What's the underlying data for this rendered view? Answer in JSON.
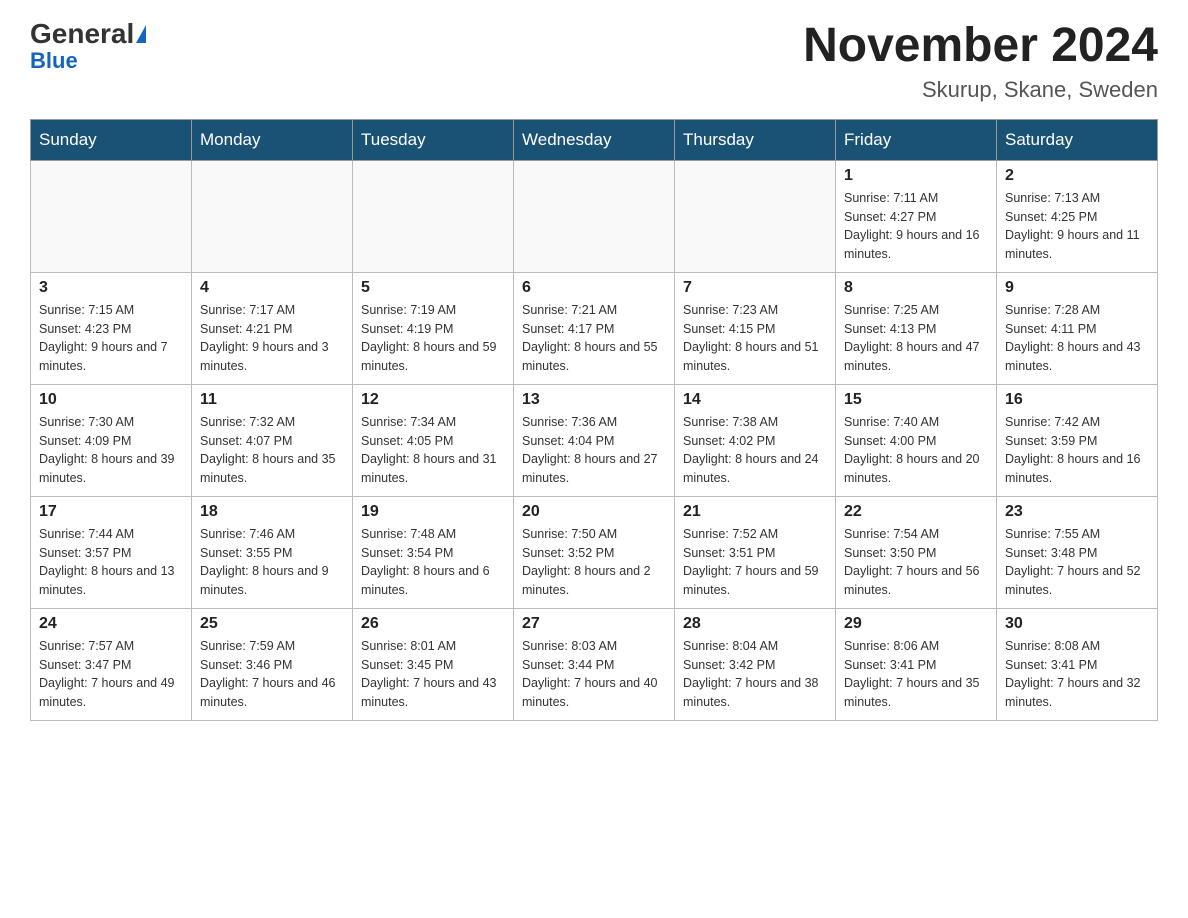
{
  "header": {
    "logo_general": "General",
    "logo_blue": "Blue",
    "title": "November 2024",
    "subtitle": "Skurup, Skane, Sweden"
  },
  "weekdays": [
    "Sunday",
    "Monday",
    "Tuesday",
    "Wednesday",
    "Thursday",
    "Friday",
    "Saturday"
  ],
  "weeks": [
    [
      {
        "day": "",
        "info": ""
      },
      {
        "day": "",
        "info": ""
      },
      {
        "day": "",
        "info": ""
      },
      {
        "day": "",
        "info": ""
      },
      {
        "day": "",
        "info": ""
      },
      {
        "day": "1",
        "info": "Sunrise: 7:11 AM\nSunset: 4:27 PM\nDaylight: 9 hours and 16 minutes."
      },
      {
        "day": "2",
        "info": "Sunrise: 7:13 AM\nSunset: 4:25 PM\nDaylight: 9 hours and 11 minutes."
      }
    ],
    [
      {
        "day": "3",
        "info": "Sunrise: 7:15 AM\nSunset: 4:23 PM\nDaylight: 9 hours and 7 minutes."
      },
      {
        "day": "4",
        "info": "Sunrise: 7:17 AM\nSunset: 4:21 PM\nDaylight: 9 hours and 3 minutes."
      },
      {
        "day": "5",
        "info": "Sunrise: 7:19 AM\nSunset: 4:19 PM\nDaylight: 8 hours and 59 minutes."
      },
      {
        "day": "6",
        "info": "Sunrise: 7:21 AM\nSunset: 4:17 PM\nDaylight: 8 hours and 55 minutes."
      },
      {
        "day": "7",
        "info": "Sunrise: 7:23 AM\nSunset: 4:15 PM\nDaylight: 8 hours and 51 minutes."
      },
      {
        "day": "8",
        "info": "Sunrise: 7:25 AM\nSunset: 4:13 PM\nDaylight: 8 hours and 47 minutes."
      },
      {
        "day": "9",
        "info": "Sunrise: 7:28 AM\nSunset: 4:11 PM\nDaylight: 8 hours and 43 minutes."
      }
    ],
    [
      {
        "day": "10",
        "info": "Sunrise: 7:30 AM\nSunset: 4:09 PM\nDaylight: 8 hours and 39 minutes."
      },
      {
        "day": "11",
        "info": "Sunrise: 7:32 AM\nSunset: 4:07 PM\nDaylight: 8 hours and 35 minutes."
      },
      {
        "day": "12",
        "info": "Sunrise: 7:34 AM\nSunset: 4:05 PM\nDaylight: 8 hours and 31 minutes."
      },
      {
        "day": "13",
        "info": "Sunrise: 7:36 AM\nSunset: 4:04 PM\nDaylight: 8 hours and 27 minutes."
      },
      {
        "day": "14",
        "info": "Sunrise: 7:38 AM\nSunset: 4:02 PM\nDaylight: 8 hours and 24 minutes."
      },
      {
        "day": "15",
        "info": "Sunrise: 7:40 AM\nSunset: 4:00 PM\nDaylight: 8 hours and 20 minutes."
      },
      {
        "day": "16",
        "info": "Sunrise: 7:42 AM\nSunset: 3:59 PM\nDaylight: 8 hours and 16 minutes."
      }
    ],
    [
      {
        "day": "17",
        "info": "Sunrise: 7:44 AM\nSunset: 3:57 PM\nDaylight: 8 hours and 13 minutes."
      },
      {
        "day": "18",
        "info": "Sunrise: 7:46 AM\nSunset: 3:55 PM\nDaylight: 8 hours and 9 minutes."
      },
      {
        "day": "19",
        "info": "Sunrise: 7:48 AM\nSunset: 3:54 PM\nDaylight: 8 hours and 6 minutes."
      },
      {
        "day": "20",
        "info": "Sunrise: 7:50 AM\nSunset: 3:52 PM\nDaylight: 8 hours and 2 minutes."
      },
      {
        "day": "21",
        "info": "Sunrise: 7:52 AM\nSunset: 3:51 PM\nDaylight: 7 hours and 59 minutes."
      },
      {
        "day": "22",
        "info": "Sunrise: 7:54 AM\nSunset: 3:50 PM\nDaylight: 7 hours and 56 minutes."
      },
      {
        "day": "23",
        "info": "Sunrise: 7:55 AM\nSunset: 3:48 PM\nDaylight: 7 hours and 52 minutes."
      }
    ],
    [
      {
        "day": "24",
        "info": "Sunrise: 7:57 AM\nSunset: 3:47 PM\nDaylight: 7 hours and 49 minutes."
      },
      {
        "day": "25",
        "info": "Sunrise: 7:59 AM\nSunset: 3:46 PM\nDaylight: 7 hours and 46 minutes."
      },
      {
        "day": "26",
        "info": "Sunrise: 8:01 AM\nSunset: 3:45 PM\nDaylight: 7 hours and 43 minutes."
      },
      {
        "day": "27",
        "info": "Sunrise: 8:03 AM\nSunset: 3:44 PM\nDaylight: 7 hours and 40 minutes."
      },
      {
        "day": "28",
        "info": "Sunrise: 8:04 AM\nSunset: 3:42 PM\nDaylight: 7 hours and 38 minutes."
      },
      {
        "day": "29",
        "info": "Sunrise: 8:06 AM\nSunset: 3:41 PM\nDaylight: 7 hours and 35 minutes."
      },
      {
        "day": "30",
        "info": "Sunrise: 8:08 AM\nSunset: 3:41 PM\nDaylight: 7 hours and 32 minutes."
      }
    ]
  ]
}
